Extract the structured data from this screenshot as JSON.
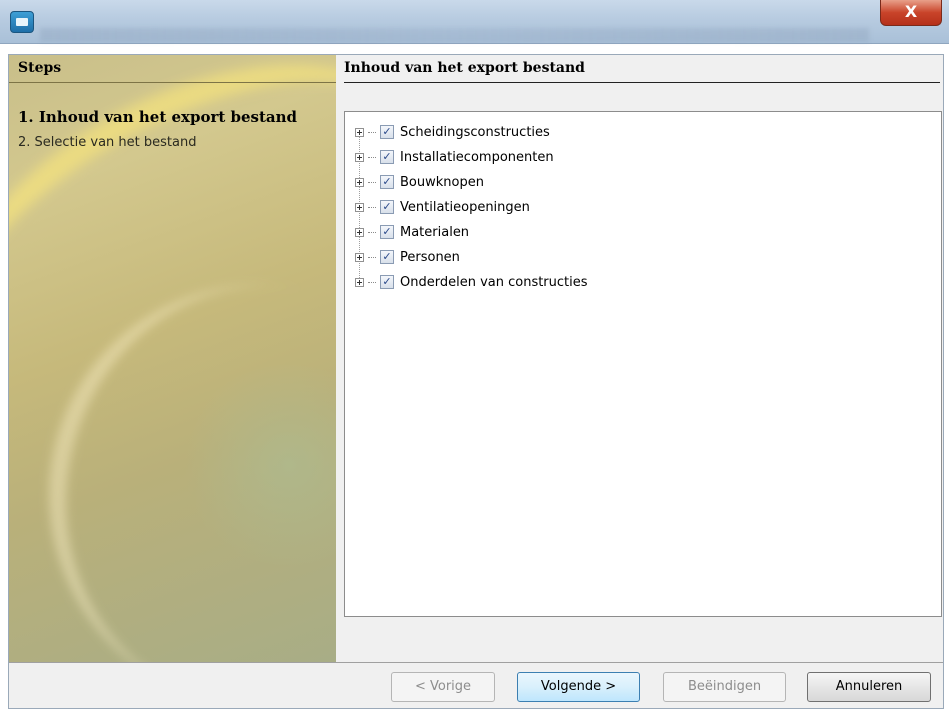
{
  "window": {
    "close_glyph": "X"
  },
  "steps": {
    "header": "Steps",
    "items": [
      {
        "label": "1. Inhoud van het export bestand",
        "active": true
      },
      {
        "label": "2. Selectie van het bestand",
        "active": false
      }
    ]
  },
  "content": {
    "header": "Inhoud van het export bestand",
    "tree": [
      {
        "label": "Scheidingsconstructies",
        "checked": true
      },
      {
        "label": "Installatiecomponenten",
        "checked": true
      },
      {
        "label": "Bouwknopen",
        "checked": true
      },
      {
        "label": "Ventilatieopeningen",
        "checked": true
      },
      {
        "label": "Materialen",
        "checked": true
      },
      {
        "label": "Personen",
        "checked": true
      },
      {
        "label": "Onderdelen van constructies",
        "checked": true
      }
    ]
  },
  "footer": {
    "prev_label": "< Vorige",
    "next_label": "Volgende >",
    "finish_label": "Beëindigen",
    "cancel_label": "Annuleren"
  },
  "icons": {
    "check_glyph": "✓"
  }
}
